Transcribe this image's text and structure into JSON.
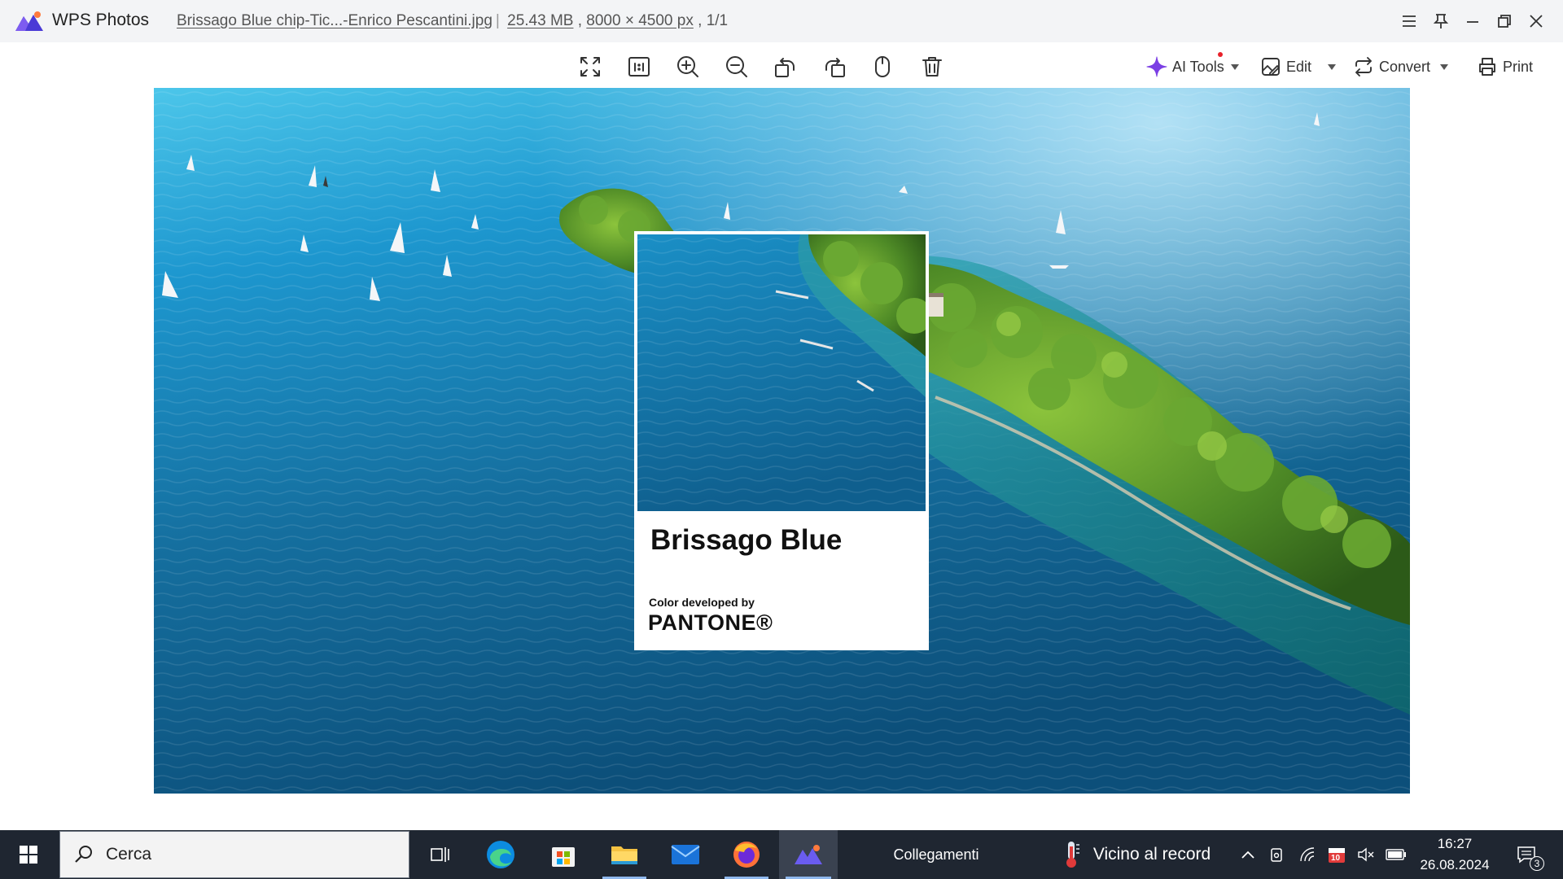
{
  "app": {
    "name": "WPS Photos",
    "logo_icon": "wps-photos-mountain-logo"
  },
  "file": {
    "name": "Brissago Blue chip-Tic...-Enrico Pescantini.jpg",
    "size": "25.43 MB",
    "dimensions": "8000 × 4500 px",
    "position": "1/1"
  },
  "toolbar": {
    "tools": [
      {
        "name": "fullscreen",
        "icon": "expand-icon"
      },
      {
        "name": "actual-size",
        "icon": "one-to-one-icon"
      },
      {
        "name": "zoom-in",
        "icon": "zoom-in-icon"
      },
      {
        "name": "zoom-out",
        "icon": "zoom-out-icon"
      },
      {
        "name": "rotate-left",
        "icon": "rotate-left-icon"
      },
      {
        "name": "rotate-right",
        "icon": "rotate-right-icon"
      },
      {
        "name": "mouse-mode",
        "icon": "mouse-icon"
      },
      {
        "name": "delete",
        "icon": "trash-icon"
      }
    ],
    "ai_tools_label": "AI Tools",
    "edit_label": "Edit",
    "convert_label": "Convert",
    "print_label": "Print",
    "accent_color": "#7b3fe4"
  },
  "photo": {
    "card_title": "Brissago Blue",
    "card_subtitle": "Color developed by",
    "card_brand": "PANTONE®",
    "water_color": "#1f7fb6",
    "island_color": "#4f8a2a"
  },
  "taskbar": {
    "search_placeholder": "Cerca",
    "widgets_label": "Collegamenti",
    "weather_text": "Vicino al record",
    "time": "16:27",
    "date": "26.08.2024",
    "notifications_count": "3",
    "calendar_badge": "10",
    "apps": [
      "task-view",
      "edge",
      "microsoft-store",
      "file-explorer",
      "mail",
      "firefox",
      "wps-photos"
    ]
  }
}
